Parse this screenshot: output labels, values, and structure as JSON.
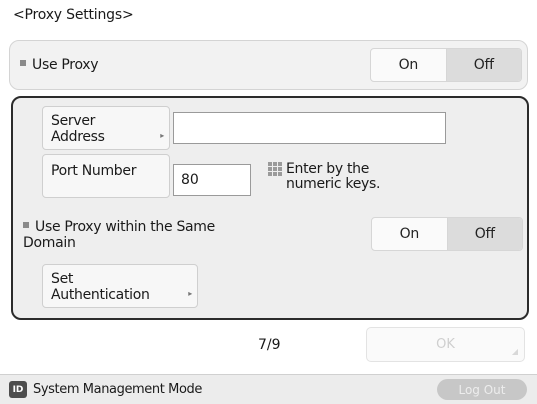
{
  "screen_title": "<Proxy Settings>",
  "use_proxy": {
    "label": "Use Proxy",
    "on_label": "On",
    "off_label": "Off",
    "selected": "Off"
  },
  "server_address": {
    "button_line1": "Server",
    "button_line2": "Address",
    "value": ""
  },
  "port_number": {
    "button_label": "Port Number",
    "value": "80"
  },
  "hint": {
    "line1": "Enter by the",
    "line2": "numeric keys."
  },
  "use_proxy_same_domain": {
    "label_line1": "Use Proxy within the Same",
    "label_line2": "Domain",
    "on_label": "On",
    "off_label": "Off",
    "selected": "Off"
  },
  "set_authentication": {
    "line1": "Set",
    "line2": "Authentication"
  },
  "page_indicator": "7/9",
  "ok_label": "OK",
  "status_bar": {
    "mode_icon_label": "ID",
    "mode_text": "System Management Mode",
    "logout_label": "Log Out"
  },
  "icons": {
    "submenu_arrow": "chevron-right-icon",
    "keypad": "keypad-icon"
  },
  "colors": {
    "frame_border": "#2b2b2b",
    "selected_segment": "#dcdcdc",
    "disabled_text": "#cfcfcf"
  }
}
